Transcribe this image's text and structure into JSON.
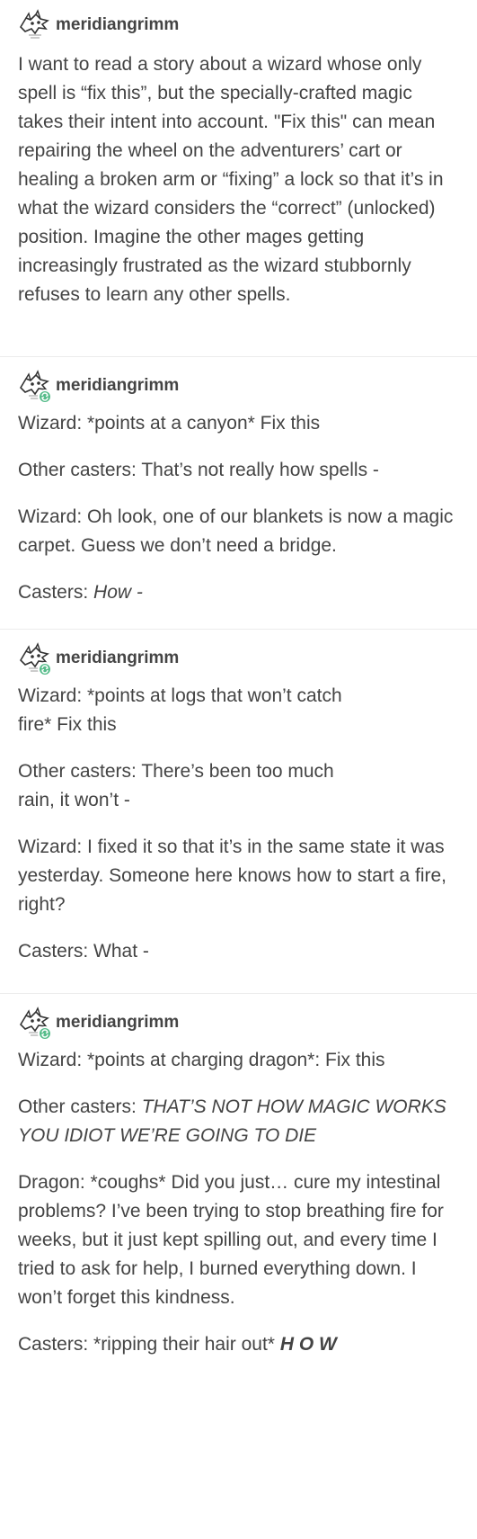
{
  "posts": [
    {
      "username": "meridiangrimm",
      "avatar_icon": "wolf-skull-avatar-icon",
      "paragraphs": [
        "I want to read a story about a wizard whose only spell is “fix this”, but the specially-crafted magic takes their intent into account.  \"Fix this\" can mean repairing the wheel on the adventurers’ cart or healing a broken arm or “fixing” a lock so that it’s in what the wizard considers the “correct” (unlocked) position.  Imagine the other mages getting increasingly frustrated as the wizard stubbornly refuses to learn any other spells."
      ]
    },
    {
      "username": "meridiangrimm",
      "avatar_icon": "wolf-skull-avatar-icon",
      "reblog_badge_icon": "reblog-icon",
      "paragraphs": [
        "Wizard: *points at a canyon* Fix this",
        "Other casters: That’s not really how spells -",
        "Wizard: Oh look, one of our blankets is now a magic carpet.  Guess we don’t need a bridge."
      ],
      "last_prefix": "Casters: ",
      "last_italic": "How -"
    },
    {
      "username": "meridiangrimm",
      "avatar_icon": "wolf-skull-avatar-icon",
      "reblog_badge_icon": "reblog-icon",
      "paragraphs": [
        "Wizard: *points at logs that won’t catch\nfire* Fix this",
        "Other casters: There’s been too much\nrain, it won’t -",
        "Wizard:  I fixed it so that it’s in the same state it was yesterday.  Someone here knows how to start a fire, right?",
        "Casters: What -"
      ]
    },
    {
      "username": "meridiangrimm",
      "avatar_icon": "wolf-skull-avatar-icon",
      "reblog_badge_icon": "reblog-icon",
      "p1": "Wizard: *points at charging dragon*: Fix this",
      "p2_prefix": "Other casters: ",
      "p2_italic": "THAT’S NOT HOW MAGIC WORKS YOU IDIOT WE’RE GOING TO DIE",
      "p3": "Dragon: *coughs* Did you just… cure my intestinal problems?  I’ve been trying to stop breathing fire for weeks, but it just kept spilling out, and every time I tried to ask for help, I burned everything down.  I won’t forget this kindness.",
      "p4_prefix": "Casters: *ripping their hair out* ",
      "p4_bold": "H O W"
    }
  ]
}
